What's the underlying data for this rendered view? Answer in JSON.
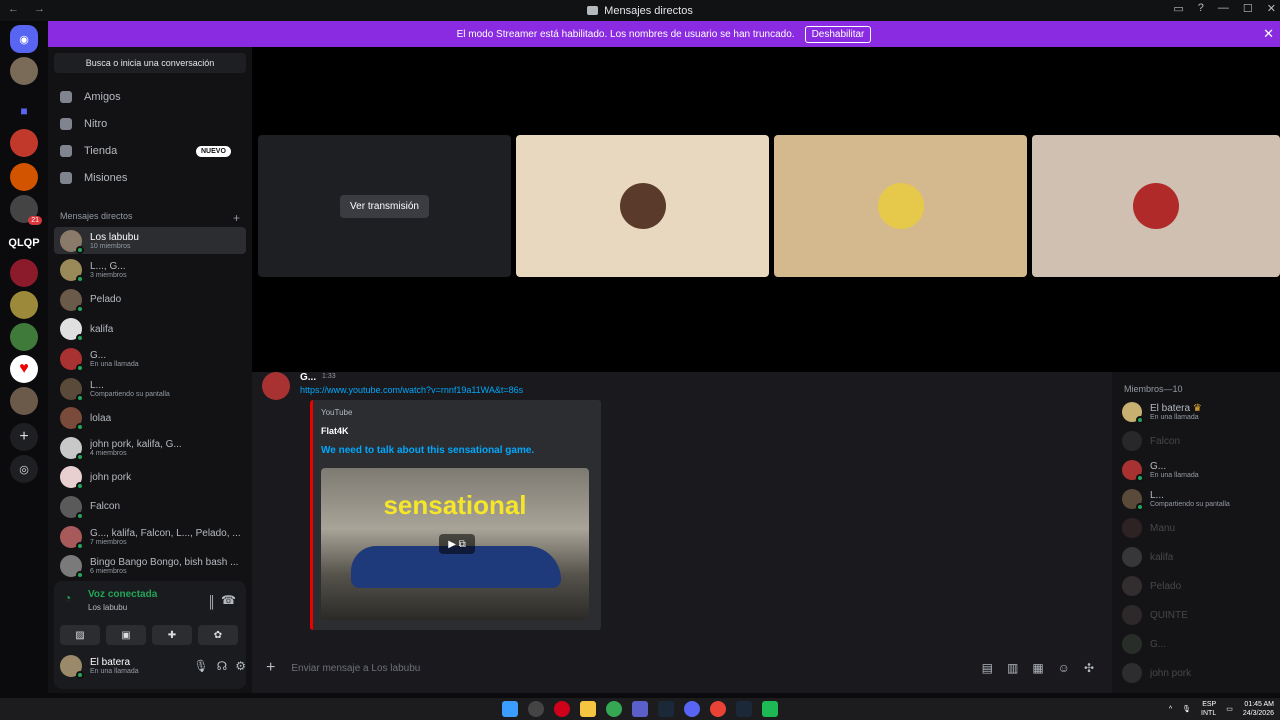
{
  "window": {
    "title": "Mensajes directos",
    "nav": "← →",
    "min": "—",
    "max": "☐",
    "close": "✕"
  },
  "banner": {
    "text": "El modo Streamer está habilitado. Los nombres de usuario se han truncado.",
    "button": "Deshabilitar",
    "close": "✕"
  },
  "servers": {
    "folder_label": "QLQP",
    "badge": "21",
    "add": "+",
    "discover": "◎"
  },
  "sidebar": {
    "search": "Busca o inicia una conversación",
    "nav": [
      {
        "label": "Amigos"
      },
      {
        "label": "Nitro"
      },
      {
        "label": "Tienda"
      },
      {
        "label": "Misiones"
      }
    ],
    "new_badge": "NUEVO",
    "dm_header": "Mensajes directos",
    "dm_add": "+",
    "dms": [
      {
        "name": "Los labubu",
        "sub": "10 miembros",
        "active": true
      },
      {
        "name": "L..., G...",
        "sub": "3 miembros"
      },
      {
        "name": "Pelado",
        "sub": ""
      },
      {
        "name": "kalifa",
        "sub": ""
      },
      {
        "name": "G...",
        "sub": "En una llamada"
      },
      {
        "name": "L...",
        "sub": "Compartiendo su pantalla"
      },
      {
        "name": "lolaa",
        "sub": ""
      },
      {
        "name": "john pork, kalifa, G...",
        "sub": "4 miembros"
      },
      {
        "name": "john pork",
        "sub": ""
      },
      {
        "name": "Falcon",
        "sub": ""
      },
      {
        "name": "G..., kalifa, Falcon, L..., Pelado, ...",
        "sub": "7 miembros"
      },
      {
        "name": "Bingo Bango Bongo, bish bash ...",
        "sub": "6 miembros"
      }
    ],
    "voice": {
      "title": "Voz conectada",
      "channel": "Los labubu"
    },
    "user": {
      "name": "El batera",
      "status": "En una llamada"
    }
  },
  "stage": {
    "stream_button": "Ver transmisión"
  },
  "message": {
    "author": "G...",
    "time": "1:33",
    "link": "https://www.youtube.com/watch?v=rnnf19a11WA&t=86s",
    "embed": {
      "provider": "YouTube",
      "author": "Flat4K",
      "title": "We need to talk about this sensational game.",
      "thumb_text": "sensational"
    }
  },
  "composer": {
    "placeholder": "Enviar mensaje a Los labubu",
    "add": "+"
  },
  "members": {
    "title": "Miembros—10",
    "list": [
      {
        "name": "El batera",
        "sub": "En una llamada",
        "crown": "♛",
        "online": true
      },
      {
        "name": "Falcon",
        "sub": "",
        "online": false
      },
      {
        "name": "G...",
        "sub": "En una llamada",
        "online": true
      },
      {
        "name": "L...",
        "sub": "Compartiendo su pantalla",
        "online": true
      },
      {
        "name": "Manu",
        "sub": "",
        "online": false
      },
      {
        "name": "kalifa",
        "sub": "",
        "online": false
      },
      {
        "name": "Pelado",
        "sub": "",
        "online": false
      },
      {
        "name": "QUINTE",
        "sub": "",
        "online": false
      },
      {
        "name": "G...",
        "sub": "",
        "online": false
      },
      {
        "name": "john pork",
        "sub": "",
        "online": false
      }
    ]
  },
  "taskbar": {
    "lang": "ESP",
    "lang2": "INTL",
    "time": "01:45 AM",
    "date": "24/3/2026"
  },
  "colors": {
    "accent": "#5865f2",
    "banner": "#8a2be2",
    "online": "#23a55a",
    "link": "#00a8fc",
    "embed_border": "#ee0000"
  }
}
